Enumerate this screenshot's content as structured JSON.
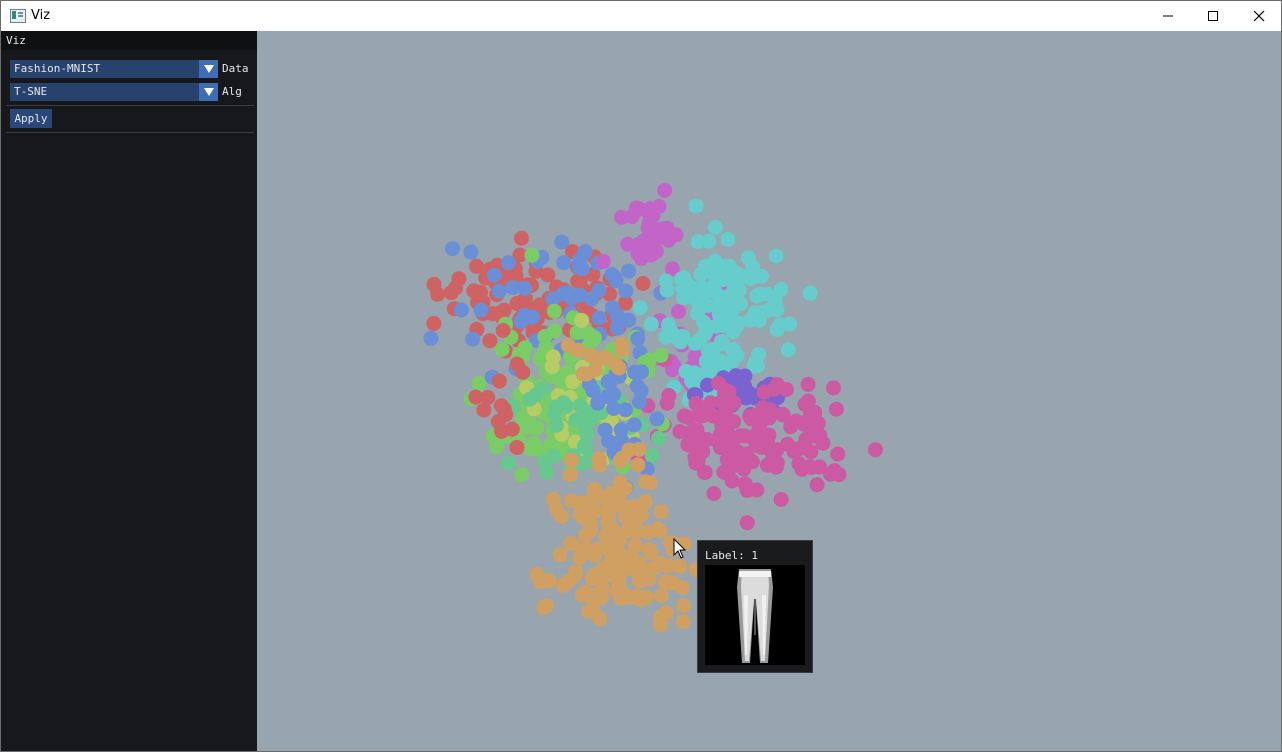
{
  "window": {
    "title": "Viz"
  },
  "sidebar": {
    "title": "Viz",
    "dataset": {
      "value": "Fashion-MNIST",
      "label": "Data"
    },
    "algorithm": {
      "value": "T-SNE",
      "label": "Alg"
    },
    "apply_label": "Apply"
  },
  "tooltip": {
    "label": "Label: 1"
  },
  "colors": {
    "canvas_bg": "#98a4ae",
    "sidebar_bg": "#16181b",
    "combo_bg": "#26426d",
    "combo_arrow": "#3f6eb4",
    "class_0": "#cf6262",
    "class_1": "#d0a062",
    "class_2": "#7acc66",
    "class_3": "#66cccc",
    "class_4": "#6a8fd6",
    "class_5": "#c264c8",
    "class_6": "#cb5aa2",
    "class_7": "#7a62d0",
    "class_8": "#b8cc66",
    "class_9": "#66c88e"
  },
  "icons": {
    "app": "app-window-icon",
    "minimize": "minimize-icon",
    "maximize": "maximize-icon",
    "close": "close-icon",
    "cursor": "arrow-cursor-icon"
  }
}
